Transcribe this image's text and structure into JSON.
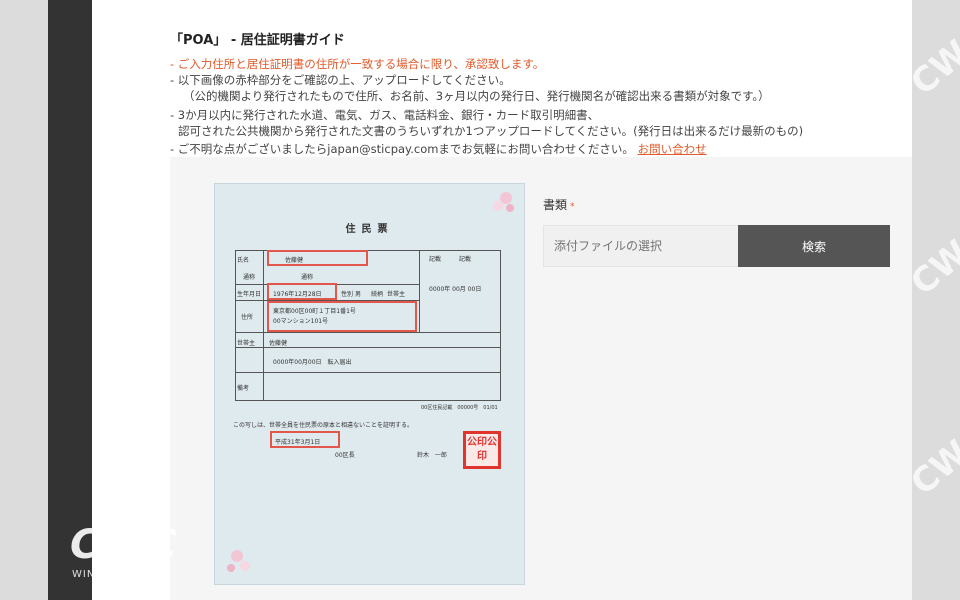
{
  "watermark": {
    "casino": "CASINO",
    "cwc": "CWC",
    "winners_club": "WINNER'S CLUB"
  },
  "guide": {
    "title": "「POA」 - 居住証明書ガイド",
    "notes": [
      "- ご入力住所と居住証明書の住所が一致する場合に限り、承認致します。",
      "- 以下画像の赤枠部分をご確認の上、アップロードしてください。",
      "（公的機関より発行されたもので住所、お名前、3ヶ月以内の発行日、発行機関名が確認出来る書類が対象です。）",
      "- 3か月以内に発行された水道、電気、ガス、電話料金、銀行・カード取引明細書、",
      "認可された公共機関から発行された文書のうちいずれか1つアップロードしてください。(発行日は出来るだけ最新のもの)",
      "- ご不明な点がございましたらjapan@sticpay.comまでお気軽にお問い合わせください。"
    ],
    "contact_link": "お問い合わせ"
  },
  "sample_document": {
    "title": "住民票",
    "name_label": "氏名",
    "name": "佐藤健",
    "alias_label": "通称",
    "alias": "通称",
    "birth_label": "生年月日",
    "birthdate": "1976年12月28日",
    "sex_label": "性別",
    "sex": "男",
    "relation_label": "続柄",
    "relation": "世帯主",
    "address_label": "住所",
    "address_line1": "東京都00区00町１丁目1番1号",
    "address_line2": "00マンション101号",
    "head_label": "世帯主",
    "head": "佐藤健",
    "date_right": "0000年 00月 00日",
    "moved_in": "0000年00月00日　転入届出",
    "remarks_label": "備考",
    "footer_small": "00区住民記載　00000号　01/01",
    "certification": "この写しは、世帯全員を住民票の原本と相違ないことを証明する。",
    "issue_date": "平成31年3月1日",
    "issuer": "00区長",
    "official": "鈴木　一郎",
    "stamp": "公印公印",
    "right_col_labels": [
      "記載",
      "記載"
    ]
  },
  "form": {
    "doc_type_label": "書類",
    "required_mark": "*",
    "file_placeholder": "添付ファイルの選択",
    "search_button": "検索"
  }
}
